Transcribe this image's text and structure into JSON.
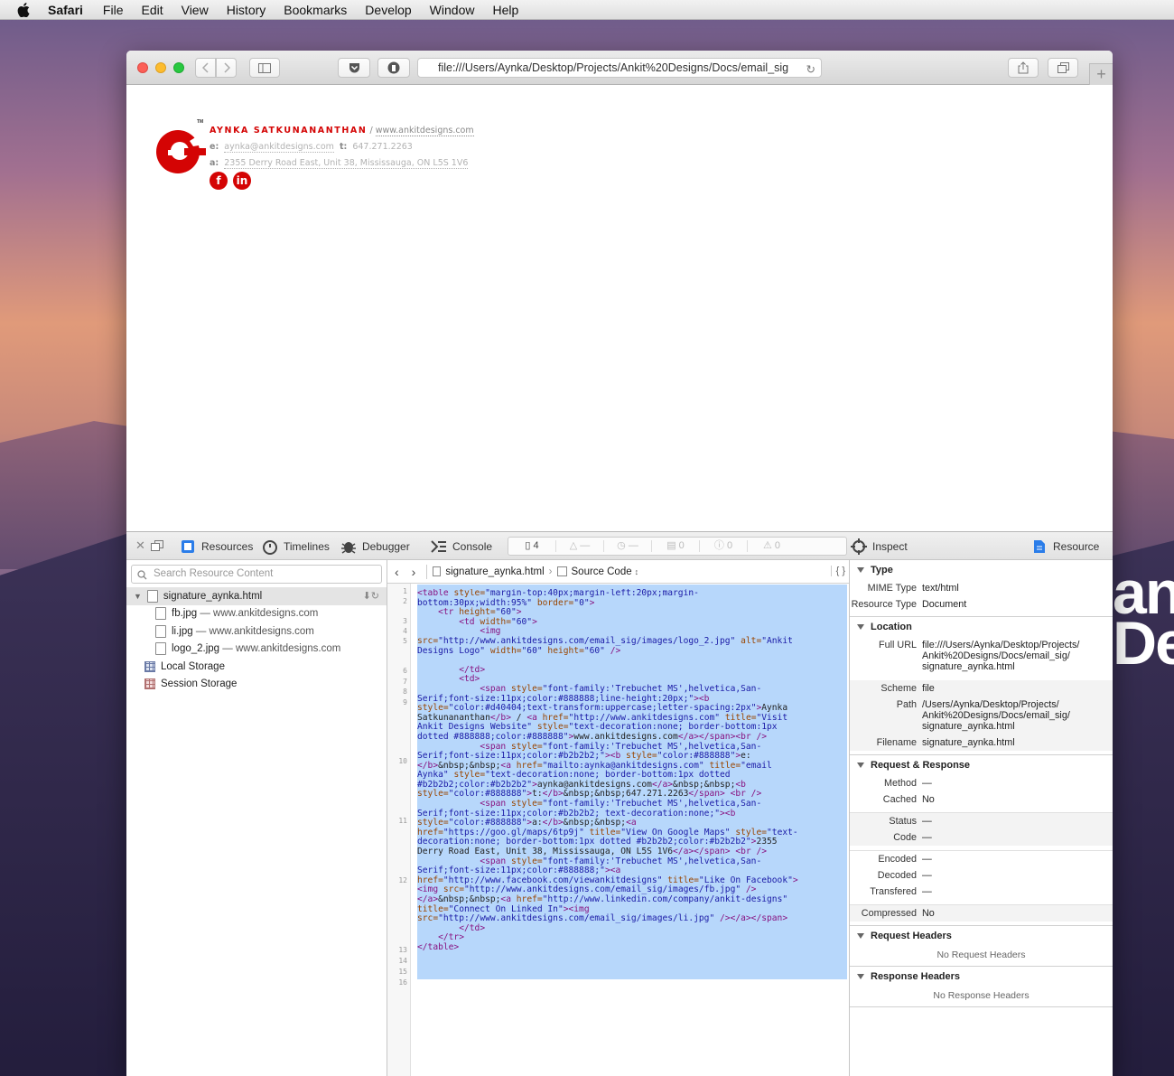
{
  "menubar": {
    "app": "Safari",
    "items": [
      "File",
      "Edit",
      "View",
      "History",
      "Bookmarks",
      "Develop",
      "Window",
      "Help"
    ]
  },
  "desktop": {
    "brand_fragment": "an De"
  },
  "browser": {
    "url": "file:///Users/Aynka/Desktop/Projects/Ankit%20Designs/Docs/email_sig"
  },
  "signature": {
    "name": "Aynka Satkunananthan",
    "sep": " / ",
    "website": "www.ankitdesigns.com",
    "email_label": "e:",
    "email": "aynka@ankitdesigns.com",
    "tel_label": "t:",
    "tel": "647.271.2263",
    "addr_label": "a:",
    "address": "2355 Derry Road East, Unit 38, Mississauga, ON L5S 1V6",
    "tm": "TM",
    "facebook": "f",
    "linkedin": "in"
  },
  "inspector": {
    "tabs": {
      "resources": "Resources",
      "timelines": "Timelines",
      "debugger": "Debugger",
      "console": "Console",
      "inspect": "Inspect",
      "resource": "Resource"
    },
    "dashboard": {
      "resources": "4",
      "errors_dash": "—",
      "time_dash": "—",
      "logs": "0",
      "errors": "0",
      "warnings": "0"
    },
    "search_placeholder": "Search Resource Content",
    "tree": {
      "root": "signature_aynka.html",
      "items": [
        {
          "name": "fb.jpg",
          "sub": "— www.ankitdesigns.com"
        },
        {
          "name": "li.jpg",
          "sub": "— www.ankitdesigns.com"
        },
        {
          "name": "logo_2.jpg",
          "sub": "— www.ankitdesigns.com"
        }
      ],
      "local_storage": "Local Storage",
      "session_storage": "Session Storage"
    },
    "code": {
      "file": "signature_aynka.html",
      "mode": "Source Code",
      "line_numbers": [
        "1",
        "2",
        "3",
        "4",
        "5",
        "6",
        "7",
        "8",
        "9",
        "10",
        "11",
        "12",
        "13",
        "14",
        "15",
        "16"
      ]
    },
    "details": {
      "type_h": "Type",
      "mime_k": "MIME Type",
      "mime_v": "text/html",
      "rtype_k": "Resource Type",
      "rtype_v": "Document",
      "loc_h": "Location",
      "full_k": "Full URL",
      "full_v": "file:///Users/Aynka/Desktop/Projects/ Ankit%20Designs/Docs/email_sig/ signature_aynka.html",
      "scheme_k": "Scheme",
      "scheme_v": "file",
      "path_k": "Path",
      "path_v": "/Users/Aynka/Desktop/Projects/ Ankit%20Designs/Docs/email_sig/ signature_aynka.html",
      "fname_k": "Filename",
      "fname_v": "signature_aynka.html",
      "rr_h": "Request & Response",
      "method_k": "Method",
      "method_v": "—",
      "cached_k": "Cached",
      "cached_v": "No",
      "status_k": "Status",
      "status_v": "—",
      "codek": "Code",
      "code_v": "—",
      "enc_k": "Encoded",
      "enc_v": "—",
      "dec_k": "Decoded",
      "dec_v": "—",
      "trans_k": "Transfered",
      "trans_v": "—",
      "comp_k": "Compressed",
      "comp_v": "No",
      "reqh_h": "Request Headers",
      "reqh_none": "No Request Headers",
      "resh_h": "Response Headers",
      "resh_none": "No Response Headers"
    }
  }
}
